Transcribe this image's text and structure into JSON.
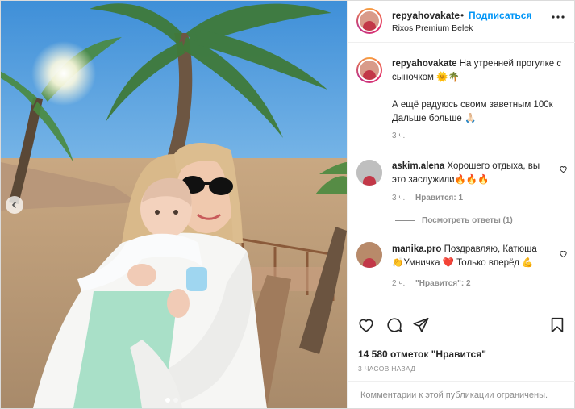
{
  "header": {
    "username": "repyahovakate",
    "dot": "•",
    "follow_label": "Подписаться",
    "location": "Rixos Premium Belek",
    "more": "•••"
  },
  "caption": {
    "username": "repyahovakate",
    "line1": "На утренней прогулке с",
    "line2": "сыночком 🌞🌴",
    "line3": "А ещё радуюсь своим заветным 100к",
    "line4": "Дальше больше 🙏🏻",
    "time": "3 ч."
  },
  "comments": [
    {
      "username": "askim.alena",
      "line1": "Хорошего отдыха, вы",
      "line2": "это заслужили🔥🔥🔥",
      "time": "3 ч.",
      "likes": "Нравится: 1",
      "view_replies": "Посмотреть ответы (1)"
    },
    {
      "username": "manika.pro",
      "line1": "Поздравляю, Катюша",
      "line2": "👏Умничка ❤️ Только вперёд 💪",
      "time": "2 ч.",
      "likes": "\"Нравится\": 2"
    }
  ],
  "actions": {
    "likes_count": "14 580 отметок \"Нравится\"",
    "posted_ago": "3 ЧАСОВ НАЗАД"
  },
  "footer": {
    "comments_limited": "Комментарии к этой публикации ограничены."
  },
  "carousel": {
    "total": 2,
    "current": 1
  },
  "colors": {
    "link": "#0095f6",
    "muted": "#8e8e8e",
    "text": "#262626",
    "like": "#ed4956"
  },
  "icons": [
    "chevron-left-icon",
    "heart-icon",
    "comment-icon",
    "share-icon",
    "bookmark-icon",
    "more-icon"
  ]
}
